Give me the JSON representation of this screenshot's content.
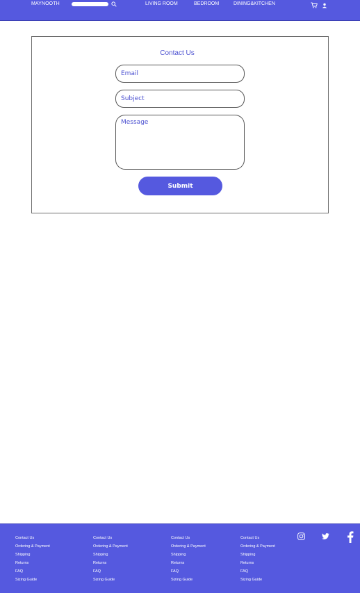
{
  "header": {
    "brand": "MAYNOOTH",
    "search": {
      "placeholder": "",
      "icon": "search-icon"
    },
    "nav": [
      {
        "label": "LIVING ROOM"
      },
      {
        "label": "BEDROOM"
      },
      {
        "label": "DINING&KITCHEN"
      }
    ],
    "icons": [
      "cart-icon",
      "user-icon"
    ]
  },
  "contact": {
    "title": "Contact Us",
    "email_placeholder": "Email",
    "subject_placeholder": "Subject",
    "message_placeholder": "Message",
    "submit_label": "Submit"
  },
  "footer": {
    "columns": [
      {
        "links": [
          "Contact Us",
          "Ordering & Payment",
          "Shipping",
          "Returns",
          "FAQ",
          "Sizing Guide"
        ]
      },
      {
        "links": [
          "Contact Us",
          "Ordering & Payment",
          "Shipping",
          "Returns",
          "FAQ",
          "Sizing Guide"
        ]
      },
      {
        "links": [
          "Contact Us",
          "Ordering & Payment",
          "Shipping",
          "Returns",
          "FAQ",
          "Sizing Guide"
        ]
      },
      {
        "links": [
          "Contact Us",
          "Ordering & Payment",
          "Shipping",
          "Returns",
          "FAQ",
          "Sizing Guide"
        ]
      }
    ],
    "social": [
      "instagram-icon",
      "twitter-icon",
      "facebook-icon"
    ]
  },
  "colors": {
    "brand": "#5559df",
    "text_accent": "#4a4fd0",
    "border": "#6e6e6e"
  }
}
